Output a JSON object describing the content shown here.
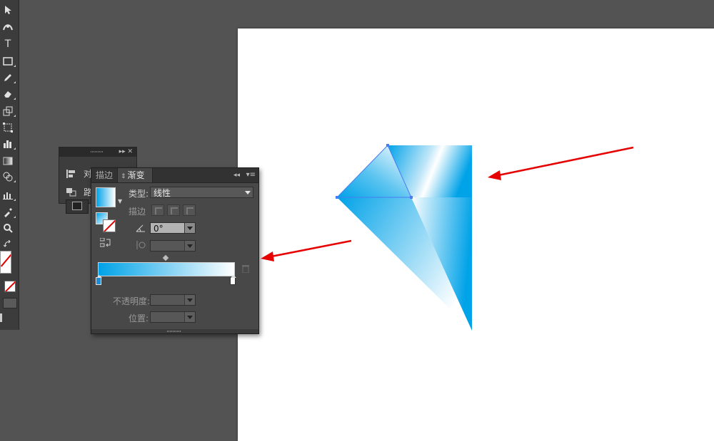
{
  "gradient_panel": {
    "tab_stroke": "描边",
    "tab_gradient": "渐变",
    "tab_gradient_arrows": "⇕",
    "collapse_glyph": "◂◂",
    "menu_glyph": "▾≡",
    "type_label": "类型:",
    "type_value": "线性",
    "stroke_label": "描边",
    "angle_value": "0°",
    "opacity_label": "不透明度:",
    "position_label": "位置:",
    "gradient_start_color": "#00a2e8",
    "gradient_end_color": "#ffffff"
  },
  "small_panel": {
    "buttons": "▸▸  ✕",
    "row1_label": "对",
    "row2_label": "路"
  },
  "toolbar": {
    "type_tool": "T",
    "icons": [
      "selection-tool-icon",
      "curvature-tool-icon",
      "type-tool-icon",
      "rectangle-tool-icon",
      "pencil-tool-icon",
      "eraser-tool-icon",
      "scale-tool-icon",
      "free-transform-icon",
      "graph-tool-icon",
      "gradient-tool-icon",
      "shape-builder-icon",
      "column-graph-icon",
      "eyedropper-tool-icon",
      "zoom-tool-icon",
      "swap-colors-icon"
    ]
  },
  "colors": {
    "arrow": "#e60000",
    "accent": "#00a2e8"
  }
}
